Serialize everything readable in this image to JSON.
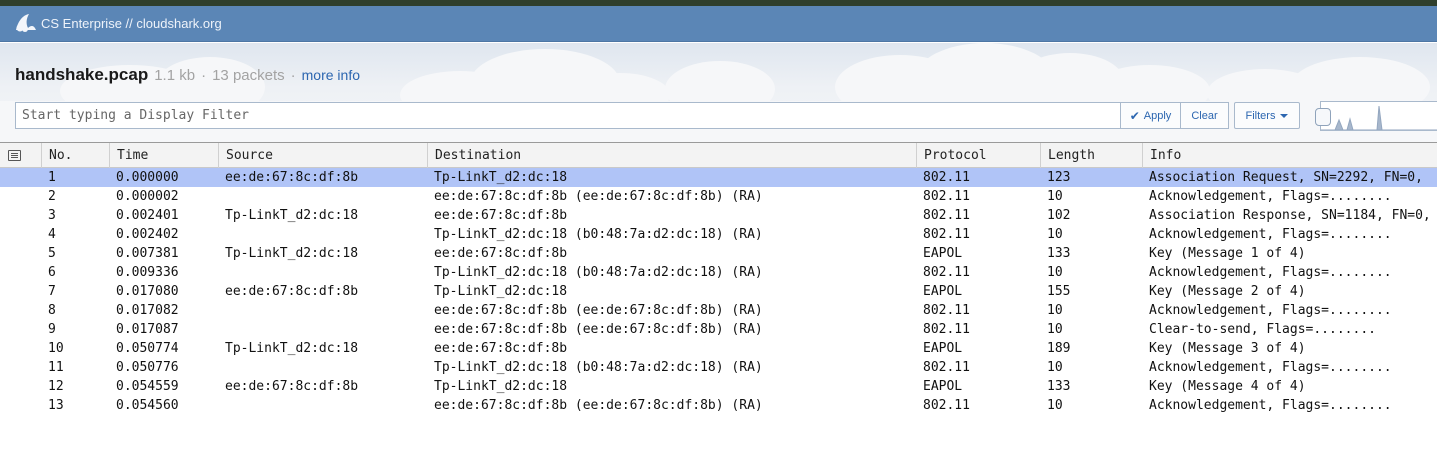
{
  "app": {
    "org_label": "CS Enterprise",
    "separator": "//",
    "domain": "cloudshark.org"
  },
  "file": {
    "name": "handshake.pcap",
    "size": "1.1 kb",
    "dot": "·",
    "packets": "13 packets",
    "more_info": "more info"
  },
  "filter": {
    "placeholder": "Start typing a Display Filter",
    "value": "",
    "apply_label": "Apply",
    "clear_label": "Clear",
    "filters_label": "Filters"
  },
  "icons": {
    "logo": "cloudshark-logo-icon",
    "apply": "check-icon",
    "filters": "caret-down-icon",
    "columns": "column-toggle-icon"
  },
  "colors": {
    "navbar": "#5b86b6",
    "link": "#2c66b0",
    "selected_row": "#b0c4f7"
  },
  "table": {
    "columns": [
      "No.",
      "Time",
      "Source",
      "Destination",
      "Protocol",
      "Length",
      "Info"
    ],
    "selected_index": 0,
    "rows": [
      [
        "1",
        "0.000000",
        "ee:de:67:8c:df:8b",
        "Tp-LinkT_d2:dc:18",
        "802.11",
        "123",
        "Association Request, SN=2292, FN=0,"
      ],
      [
        "2",
        "0.000002",
        "",
        "ee:de:67:8c:df:8b (ee:de:67:8c:df:8b) (RA)",
        "802.11",
        "10",
        "Acknowledgement, Flags=........"
      ],
      [
        "3",
        "0.002401",
        "Tp-LinkT_d2:dc:18",
        "ee:de:67:8c:df:8b",
        "802.11",
        "102",
        "Association Response, SN=1184, FN=0,"
      ],
      [
        "4",
        "0.002402",
        "",
        "Tp-LinkT_d2:dc:18 (b0:48:7a:d2:dc:18) (RA)",
        "802.11",
        "10",
        "Acknowledgement, Flags=........"
      ],
      [
        "5",
        "0.007381",
        "Tp-LinkT_d2:dc:18",
        "ee:de:67:8c:df:8b",
        "EAPOL",
        "133",
        "Key (Message 1 of 4)"
      ],
      [
        "6",
        "0.009336",
        "",
        "Tp-LinkT_d2:dc:18 (b0:48:7a:d2:dc:18) (RA)",
        "802.11",
        "10",
        "Acknowledgement, Flags=........"
      ],
      [
        "7",
        "0.017080",
        "ee:de:67:8c:df:8b",
        "Tp-LinkT_d2:dc:18",
        "EAPOL",
        "155",
        "Key (Message 2 of 4)"
      ],
      [
        "8",
        "0.017082",
        "",
        "ee:de:67:8c:df:8b (ee:de:67:8c:df:8b) (RA)",
        "802.11",
        "10",
        "Acknowledgement, Flags=........"
      ],
      [
        "9",
        "0.017087",
        "",
        "ee:de:67:8c:df:8b (ee:de:67:8c:df:8b) (RA)",
        "802.11",
        "10",
        "Clear-to-send, Flags=........"
      ],
      [
        "10",
        "0.050774",
        "Tp-LinkT_d2:dc:18",
        "ee:de:67:8c:df:8b",
        "EAPOL",
        "189",
        "Key (Message 3 of 4)"
      ],
      [
        "11",
        "0.050776",
        "",
        "Tp-LinkT_d2:dc:18 (b0:48:7a:d2:dc:18) (RA)",
        "802.11",
        "10",
        "Acknowledgement, Flags=........"
      ],
      [
        "12",
        "0.054559",
        "ee:de:67:8c:df:8b",
        "Tp-LinkT_d2:dc:18",
        "EAPOL",
        "133",
        "Key (Message 4 of 4)"
      ],
      [
        "13",
        "0.054560",
        "",
        "ee:de:67:8c:df:8b (ee:de:67:8c:df:8b) (RA)",
        "802.11",
        "10",
        "Acknowledgement, Flags=........"
      ]
    ]
  }
}
